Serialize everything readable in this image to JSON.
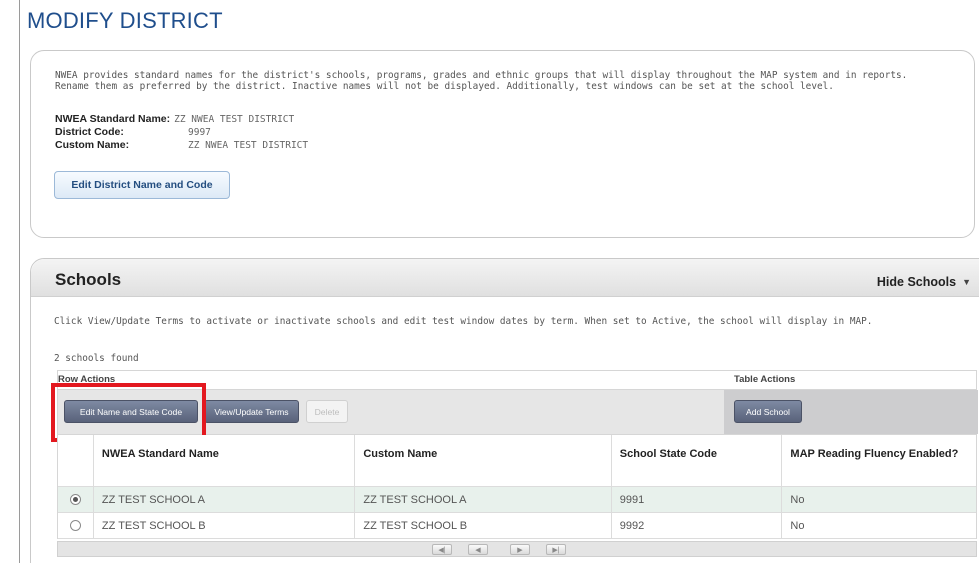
{
  "page": {
    "title": "MODIFY DISTRICT"
  },
  "district": {
    "description": "NWEA provides standard names for the district's schools, programs, grades and ethnic groups that will display throughout the MAP system and in reports. Rename them as preferred by the district. Inactive names will not be displayed. Additionally, test windows can be set at the school level.",
    "standard_name_label": "NWEA Standard Name:",
    "standard_name_value": "ZZ NWEA TEST DISTRICT",
    "code_label": "District Code:",
    "code_value": "9997",
    "custom_name_label": "Custom Name:",
    "custom_name_value": "ZZ NWEA TEST DISTRICT",
    "edit_button": "Edit District Name and Code"
  },
  "schools": {
    "title": "Schools",
    "hide_label": "Hide Schools",
    "description": "Click View/Update Terms to activate or inactivate schools and edit test window dates by term. When set to Active, the school will display in MAP.",
    "count_text": "2 schools found",
    "row_actions_label": "Row Actions",
    "table_actions_label": "Table Actions",
    "buttons": {
      "edit_name": "Edit Name and State Code",
      "view_terms": "View/Update Terms",
      "delete": "Delete",
      "add_school": "Add School"
    },
    "columns": [
      "NWEA Standard Name",
      "Custom Name",
      "School State Code",
      "MAP Reading Fluency Enabled?"
    ],
    "rows": [
      {
        "selected": true,
        "standard_name": "ZZ TEST SCHOOL A",
        "custom_name": "ZZ TEST SCHOOL A",
        "state_code": "9991",
        "fluency": "No"
      },
      {
        "selected": false,
        "standard_name": "ZZ TEST SCHOOL B",
        "custom_name": "ZZ TEST SCHOOL B",
        "state_code": "9992",
        "fluency": "No"
      }
    ],
    "pager": {
      "first": "first-page-icon",
      "prev": "prev-page-icon",
      "next": "next-page-icon",
      "last": "last-page-icon"
    }
  },
  "colors": {
    "title": "#1f4e8c",
    "highlight": "#e3181f",
    "button_dark": "#59627a"
  }
}
